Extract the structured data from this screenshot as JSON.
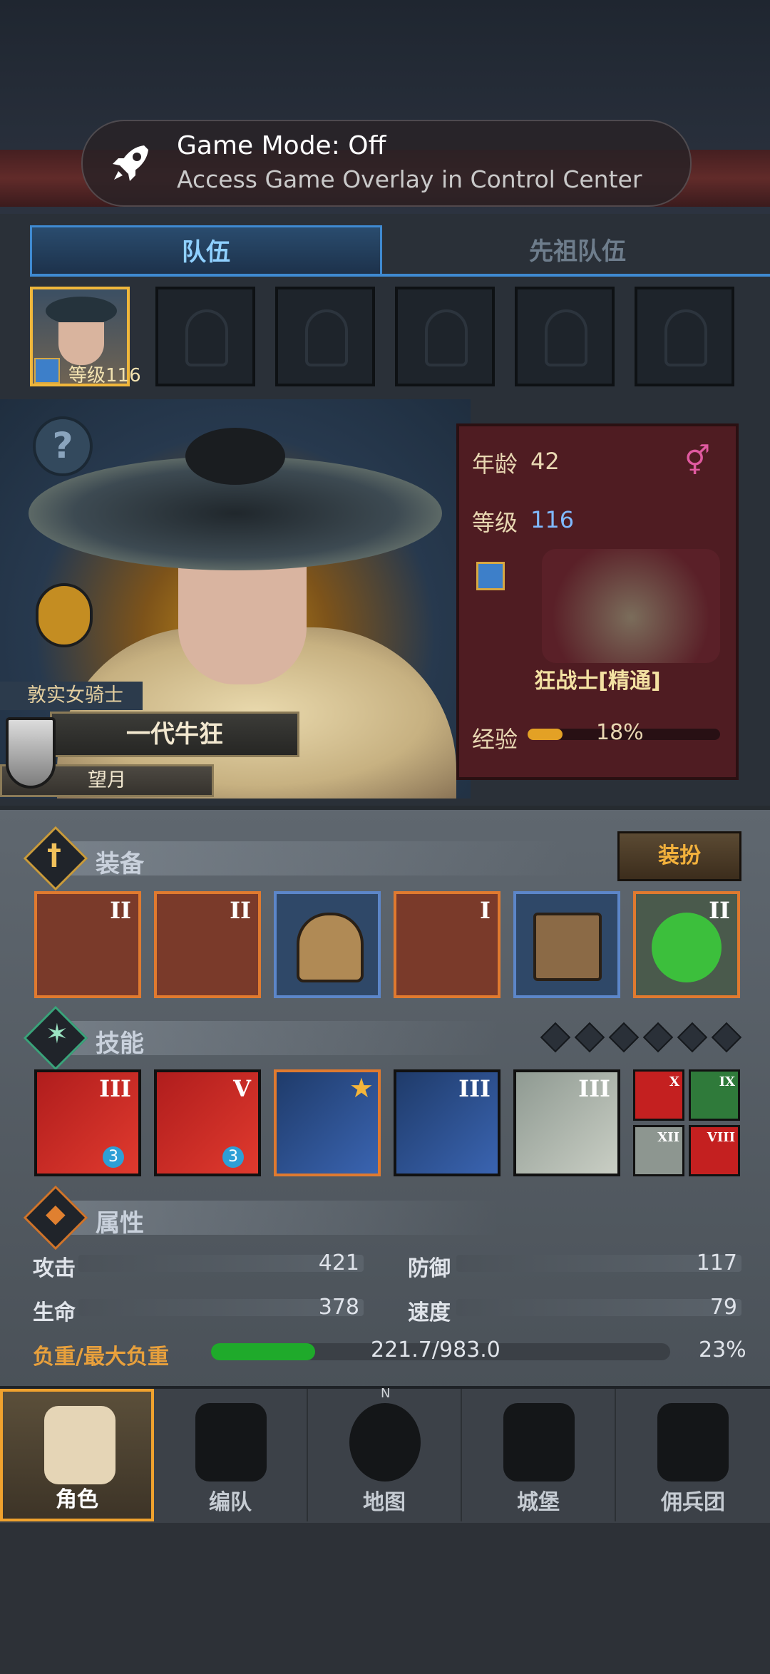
{
  "system_overlay": {
    "title": "Game Mode: Off",
    "subtitle": "Access Game Overlay in Control Center"
  },
  "tabs": [
    "队伍",
    "先祖队伍"
  ],
  "team_slot_level": "等级116",
  "character": {
    "title": "敦实女骑士",
    "name": "一代牛狂",
    "subtitle": "望月",
    "help_symbol": "?"
  },
  "info": {
    "age_label": "年龄",
    "age": "42",
    "level_label": "等级",
    "level": "116",
    "gender_symbol": "⚥",
    "class_name": "狂战士[精通]",
    "exp_label": "经验",
    "exp_percent": "18%",
    "exp_fraction": 0.18
  },
  "equipment": {
    "title": "装备",
    "dress_button": "装扮",
    "items": [
      {
        "tier": "II",
        "frame": "orange"
      },
      {
        "tier": "II",
        "frame": "orange"
      },
      {
        "tier": "",
        "frame": "blue"
      },
      {
        "tier": "I",
        "frame": "orange"
      },
      {
        "tier": "",
        "frame": "blue"
      },
      {
        "tier": "II",
        "frame": "orange"
      }
    ]
  },
  "skills": {
    "title": "技能",
    "tiers": [
      "III",
      "V",
      "",
      "III",
      "III"
    ],
    "badges": [
      "3",
      "3",
      "",
      "",
      ""
    ],
    "mini_tiers": [
      "X",
      "IX",
      "XII",
      "VIII"
    ]
  },
  "attributes": {
    "title": "属性",
    "attack_label": "攻击",
    "attack": "421",
    "defense_label": "防御",
    "defense": "117",
    "hp_label": "生命",
    "hp": "378",
    "speed_label": "速度",
    "speed": "79",
    "load_label": "负重/最大负重",
    "load_value": "221.7/983.0",
    "load_percent": "23%"
  },
  "nav": [
    "角色",
    "编队",
    "地图",
    "城堡",
    "佣兵团"
  ],
  "compass_letter": "N"
}
